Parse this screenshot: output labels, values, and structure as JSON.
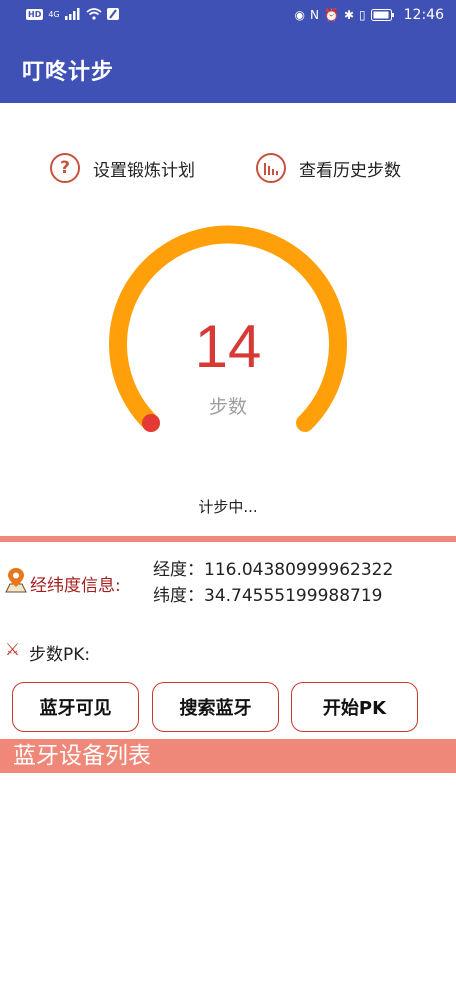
{
  "status_bar": {
    "left_badge": "HD",
    "network": "4G",
    "time": "12:46",
    "right_glyphs": [
      "◉",
      "N",
      "⏰",
      "✱",
      "▯"
    ]
  },
  "app": {
    "title": "叮咚计步"
  },
  "actions": {
    "plan_label": "设置锻炼计划",
    "history_label": "查看历史步数"
  },
  "gauge": {
    "steps": "14",
    "unit": "步数",
    "status": "计步中...",
    "progress": 0.0,
    "colors": {
      "track": "#ffa00a",
      "indicator": "#e53935"
    }
  },
  "location": {
    "title": "经纬度信息:",
    "longitude": "经度：116.04380999962322",
    "latitude": "纬度：34.74555199988719"
  },
  "pk": {
    "title": "步数PK:",
    "buttons": {
      "visible": "蓝牙可见",
      "search": "搜索蓝牙",
      "start": "开始PK"
    }
  },
  "device_list": {
    "header": "蓝牙设备列表"
  },
  "colors": {
    "primary": "#3f51b5",
    "accent_bar": "#ef8879",
    "button_border": "#c53a30"
  }
}
